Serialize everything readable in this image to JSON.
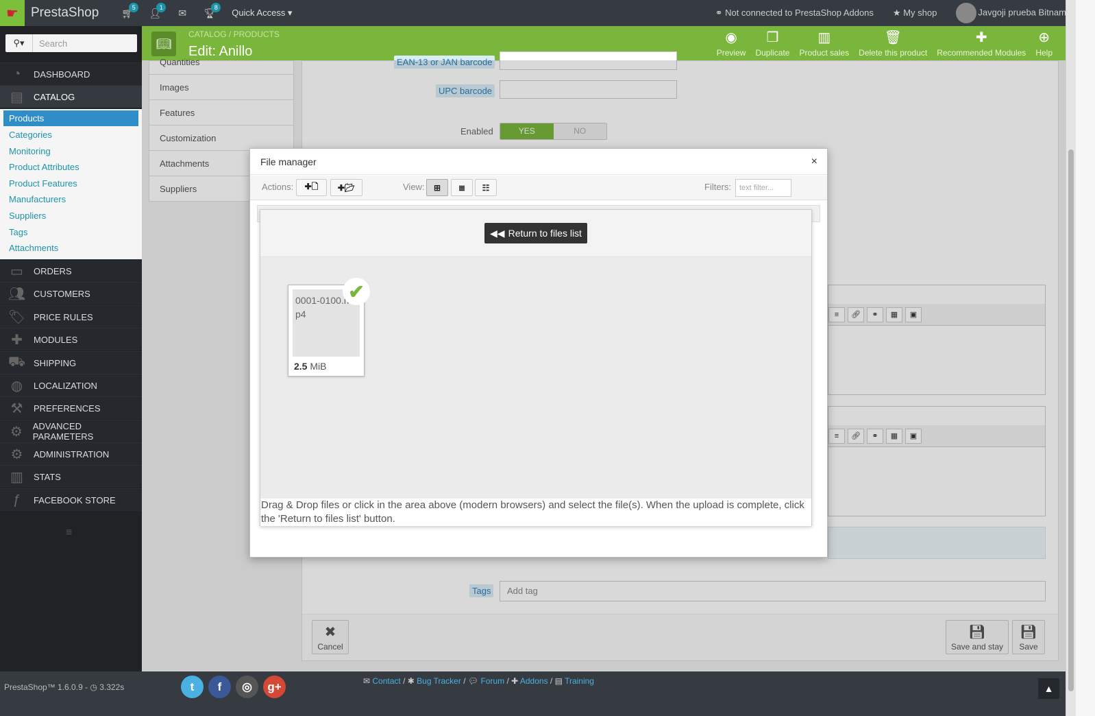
{
  "topbar": {
    "brand": "PrestaShop",
    "cart_badge": "5",
    "customers_badge": "1",
    "trophy_badge": "8",
    "quick_access": "Quick Access ▾",
    "addons_status": "Not connected to PrestaShop Addons",
    "my_shop": "My shop",
    "user": "Javgoji prueba Bitnami ▾"
  },
  "sidebar": {
    "search_placeholder": "Search",
    "nav": [
      {
        "label": "DASHBOARD",
        "icon": "dashboard-icon"
      },
      {
        "label": "CATALOG",
        "icon": "book-icon"
      },
      {
        "label": "ORDERS",
        "icon": "credit-card-icon"
      },
      {
        "label": "CUSTOMERS",
        "icon": "users-icon"
      },
      {
        "label": "PRICE RULES",
        "icon": "tags-icon"
      },
      {
        "label": "MODULES",
        "icon": "puzzle-icon"
      },
      {
        "label": "SHIPPING",
        "icon": "truck-icon"
      },
      {
        "label": "LOCALIZATION",
        "icon": "globe-icon"
      },
      {
        "label": "PREFERENCES",
        "icon": "wrench-icon"
      },
      {
        "label": "ADVANCED PARAMETERS",
        "icon": "cogs-icon"
      },
      {
        "label": "ADMINISTRATION",
        "icon": "gear-icon"
      },
      {
        "label": "STATS",
        "icon": "bar-chart-icon"
      },
      {
        "label": "FACEBOOK STORE",
        "icon": "facebook-icon"
      }
    ],
    "catalog_sub": [
      "Products",
      "Categories",
      "Monitoring",
      "Product Attributes",
      "Product Features",
      "Manufacturers",
      "Suppliers",
      "Tags",
      "Attachments"
    ]
  },
  "header": {
    "breadcrumb": "CATALOG  /  PRODUCTS",
    "title": "Edit: Anillo",
    "buttons": [
      "Preview",
      "Duplicate",
      "Product sales",
      "Delete this product",
      "Recommended Modules",
      "Help"
    ]
  },
  "product_tabs": [
    "Quantities",
    "Images",
    "Features",
    "Customization",
    "Attachments",
    "Suppliers"
  ],
  "form": {
    "ean_label": "EAN-13 or JAN barcode",
    "upc_label": "UPC barcode",
    "enabled_label": "Enabled",
    "yes": "YES",
    "no": "NO",
    "tags_label": "Tags",
    "tags_placeholder": "Add tag",
    "cancel": "Cancel",
    "save_and_stay": "Save and stay",
    "save": "Save"
  },
  "file_manager": {
    "title": "File manager",
    "close": "×",
    "actions_label": "Actions:",
    "view_label": "View:",
    "filters_label": "Filters:",
    "filter_placeholder": "text filter...",
    "return_button": "Return to files list",
    "file_name": "0001-0100.mp4",
    "file_size_value": "2.5",
    "file_size_unit": "MiB",
    "hint": "Drag & Drop files or click in the area above (modern browsers) and select the file(s). When the upload is complete, click the 'Return to files list' button."
  },
  "footer": {
    "version": "PrestaShop™ 1.6.0.9 - ◷ 3.322s",
    "links": [
      "Contact",
      "Bug Tracker",
      "Forum",
      "Addons",
      "Training"
    ]
  }
}
